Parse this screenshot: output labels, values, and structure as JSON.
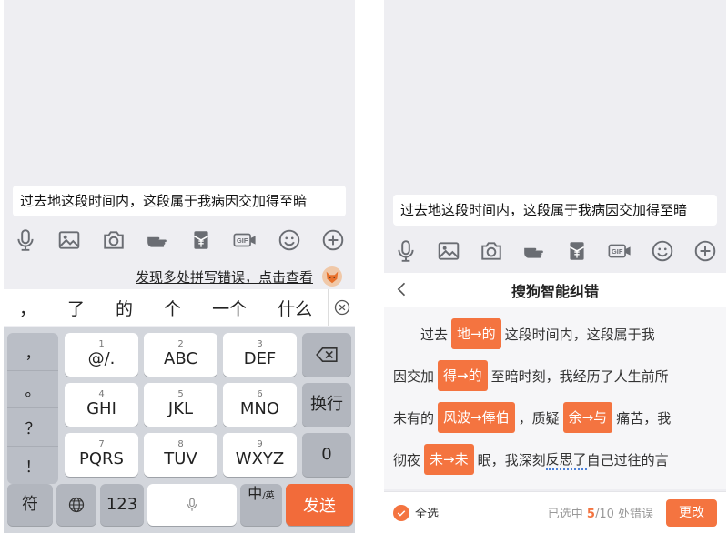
{
  "left": {
    "message": "过去地这段时间内，这段属于我病因交加得至暗",
    "suggestion": "发现多处拼写错误，点击查看",
    "candidates": [
      "，",
      "了",
      "的",
      "个",
      "一个",
      "什么"
    ],
    "side_keys": [
      "，",
      "。",
      "？",
      "！"
    ],
    "keys": [
      {
        "num": "1",
        "label": "@/."
      },
      {
        "num": "2",
        "label": "ABC"
      },
      {
        "num": "3",
        "label": "DEF"
      },
      {
        "num": "4",
        "label": "GHI"
      },
      {
        "num": "5",
        "label": "JKL"
      },
      {
        "num": "6",
        "label": "MNO"
      },
      {
        "num": "7",
        "label": "PQRS"
      },
      {
        "num": "8",
        "label": "TUV"
      },
      {
        "num": "9",
        "label": "WXYZ"
      }
    ],
    "enter_label": "换行",
    "zero_label": "0",
    "symbol_label": "符",
    "num_label": "123",
    "lang_main": "中",
    "lang_sub": "/英",
    "send_label": "发送"
  },
  "right": {
    "message": "过去地这段时间内，这段属于我病因交加得至暗",
    "title": "搜狗智能纠错",
    "lines": [
      {
        "pre": "过去",
        "chip": "地→的",
        "post": "这段时间内，这段属于我"
      },
      {
        "pre": "因交加",
        "chip": "得→的",
        "post": "至暗时刻，我经历了人生前所"
      },
      {
        "pre": "未有的",
        "chip": "风波→俸伯",
        "mid": "，质疑",
        "chip2": "余→与",
        "post": "痛苦，我"
      },
      {
        "pre": "彻夜",
        "chip": "未→未",
        "post_a": "眠，我深刻",
        "dotted": "反思了",
        "post_b": "自己过往的言"
      }
    ],
    "select_all": "全选",
    "status_pre": "已选中 ",
    "status_sel": "5",
    "status_post": "/10 处错误",
    "change_label": "更改"
  },
  "colors": {
    "accent": "#f47440",
    "send": "#f26b3a",
    "dotted": "#4a7fd8"
  }
}
